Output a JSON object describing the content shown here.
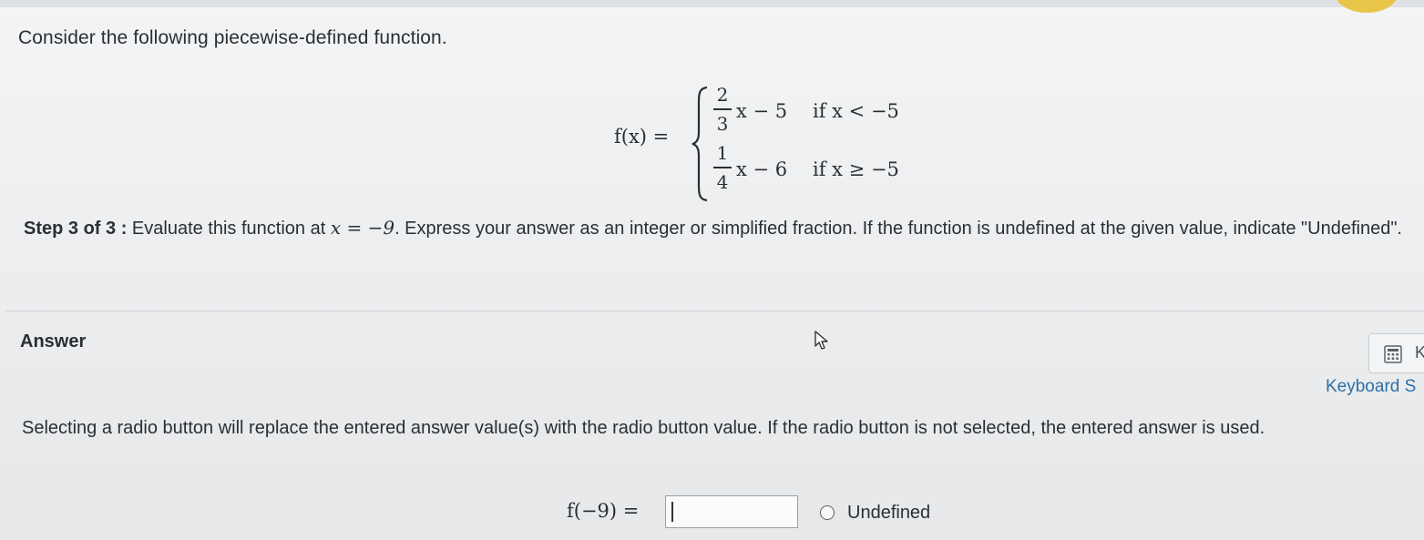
{
  "question": {
    "intro": "Consider the following piecewise-defined function.",
    "function_label": "f(x) =",
    "cases": [
      {
        "num": "2",
        "den": "3",
        "expr": "x − 5",
        "cond": "if x < −5"
      },
      {
        "num": "1",
        "den": "4",
        "expr": "x − 6",
        "cond": "if x ≥ −5"
      }
    ],
    "step_label": "Step 3 of 3 :",
    "step_text_before": " Evaluate this function at ",
    "step_math": "x = −9",
    "step_text_after": ". Express your answer as an integer or simplified fraction. If the function is undefined at the given value, indicate \"Undefined\"."
  },
  "answer": {
    "title": "Answer",
    "keyboard_link": "Keyboard S",
    "calc_letter": "K",
    "radio_note": "Selecting a radio button will replace the entered answer value(s) with the radio button value. If the radio button is not selected, the entered answer is used.",
    "eval_label": "f(−9) =",
    "input_value": "",
    "radio_label": "Undefined"
  },
  "icons": {
    "cursor": "pointer-cursor-icon",
    "calculator": "calculator-icon"
  },
  "colors": {
    "link": "#2f6fa8",
    "badge": "#e9c54a"
  }
}
